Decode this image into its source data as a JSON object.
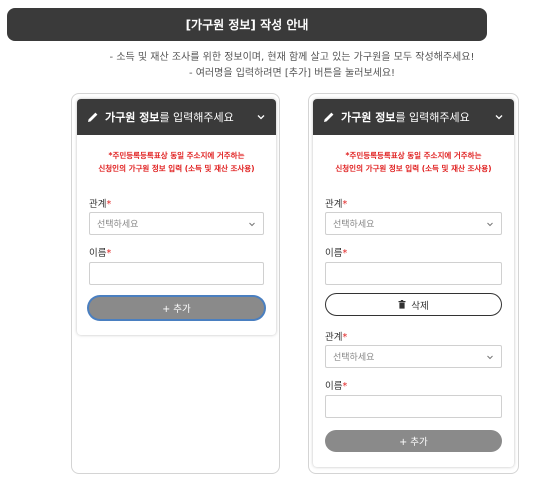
{
  "banner": {
    "title": "[가구원 정보] 작성 안내"
  },
  "notes": [
    "- 소득 및 재산 조사를 위한 정보이며, 현재 함께 살고 있는 가구원을 모두 작성해주세요!",
    "- 여러명을 입력하려면 [추가] 버튼을 눌러보세요!"
  ],
  "card": {
    "title_bold": "가구원 정보",
    "title_rest": "를 입력해주세요",
    "warning_line1": "*주민등록등록표상 동일 주소지에 거주하는",
    "warning_line2": "신청인의 가구원 정보 입력 (소득 및 재산 조사용)",
    "relation_label": "관계",
    "relation_placeholder": "선택하세요",
    "name_label": "이름",
    "required_mark": "*",
    "add_label": "+ 추가",
    "delete_label": "삭제"
  },
  "icons": {
    "header": "pencil-icon",
    "collapse": "chevron-down-icon",
    "select": "chevron-down-icon",
    "delete": "trash-icon"
  },
  "colors": {
    "header_bg": "#3a3a3a",
    "warning": "#e02020",
    "add_button": "#8a8a8a",
    "focus_ring": "#4a7fc0"
  }
}
